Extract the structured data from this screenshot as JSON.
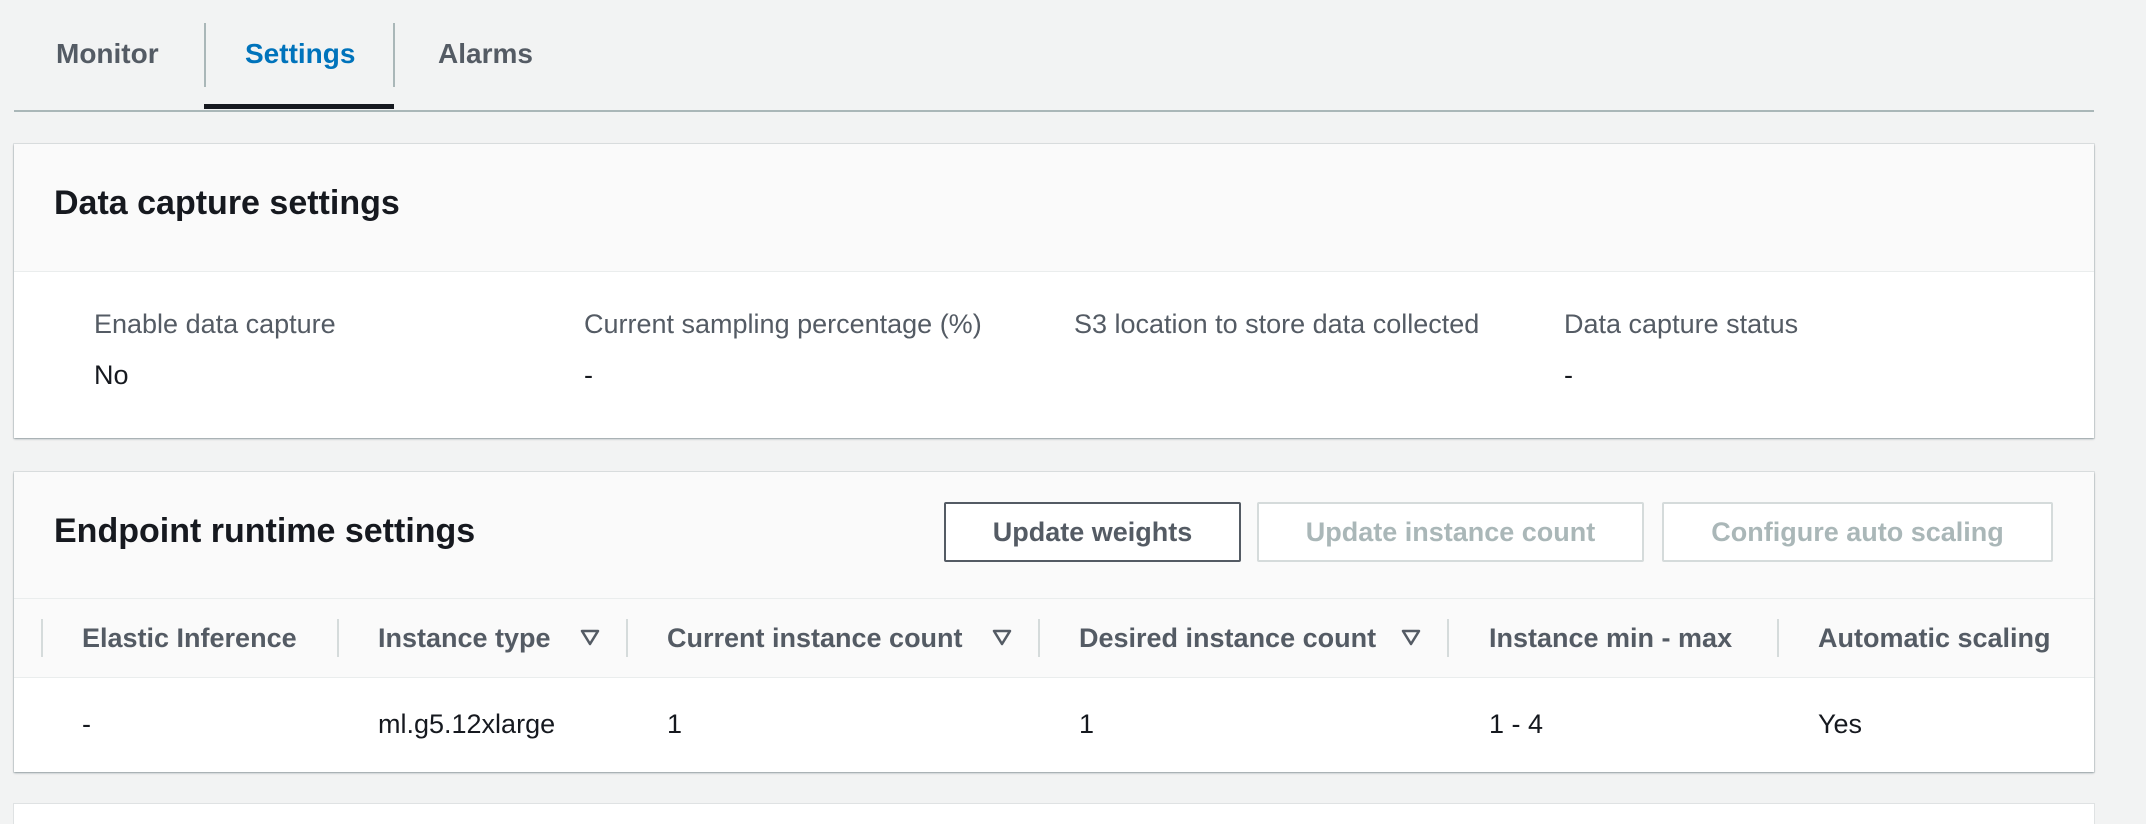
{
  "tabs": [
    {
      "label": "Monitor",
      "active": false
    },
    {
      "label": "Settings",
      "active": true
    },
    {
      "label": "Alarms",
      "active": false
    }
  ],
  "data_capture": {
    "title": "Data capture settings",
    "fields": [
      {
        "label": "Enable data capture",
        "value": "No"
      },
      {
        "label": "Current sampling percentage (%)",
        "value": "-"
      },
      {
        "label": "S3 location to store data collected",
        "value": ""
      },
      {
        "label": "Data capture status",
        "value": "-"
      }
    ]
  },
  "endpoint_runtime": {
    "title": "Endpoint runtime settings",
    "buttons": {
      "update_weights": "Update weights",
      "update_instance_count": "Update instance count",
      "configure_auto_scaling": "Configure auto scaling"
    },
    "columns": [
      "Elastic Inference",
      "Instance type",
      "Current instance count",
      "Desired instance count",
      "Instance min - max",
      "Automatic scaling"
    ],
    "rows": [
      [
        "-",
        "ml.g5.12xlarge",
        "1",
        "1",
        "1 - 4",
        "Yes"
      ]
    ]
  },
  "colors": {
    "active_tab": "#0073bb",
    "page_background": "#f2f3f3",
    "text_primary": "#16191f",
    "text_secondary": "#545b64",
    "disabled": "#aab7b8"
  },
  "icons": {
    "sort": "caret-down-outline-icon"
  }
}
